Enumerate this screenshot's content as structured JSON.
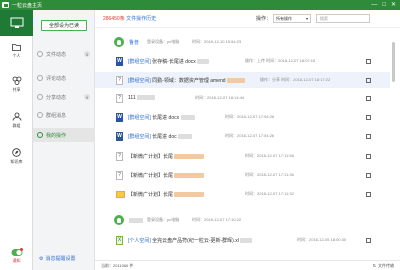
{
  "window": {
    "title": "一粒云盘主页",
    "controls": [
      "—",
      "□",
      "✕"
    ]
  },
  "leftnav": {
    "items": [
      {
        "label": "个人",
        "icon": "folder-icon"
      },
      {
        "label": "共享",
        "icon": "share-icon"
      },
      {
        "label": "群组",
        "icon": "group-icon"
      },
      {
        "label": "知识库",
        "icon": "compass-icon"
      }
    ],
    "bottom": {
      "label": "通知",
      "badge": ""
    }
  },
  "subnav": {
    "mark_read": "全部设为已读",
    "items": [
      {
        "label": "文件动态",
        "count": "5"
      },
      {
        "label": "评论动态",
        "count": ""
      },
      {
        "label": "分享动态",
        "count": "9"
      },
      {
        "label": "群组消息",
        "count": ""
      },
      {
        "label": "我的操作",
        "count": ""
      }
    ],
    "footer": "消息提醒设置"
  },
  "toolbar": {
    "count": "286450",
    "count_suffix": "条",
    "history_label": "文件操作历史",
    "operation_label": "操作：",
    "operation_select": "所有操作",
    "search_placeholder": "搜索"
  },
  "groups": [
    {
      "name": "鲁普",
      "meta": "登录设备：pc电脑",
      "time": "时间：2018-12-10 15:54:23"
    },
    {
      "name": "",
      "meta": "登录设备：pc电脑",
      "time": "时间：2018-12-07 17:10:22"
    }
  ],
  "rows": [
    {
      "tag": "[群组空间]",
      "text": "张存稿-长尾进 docx",
      "meta": "操作：上传   时间：2018-12-07 18:07:15"
    },
    {
      "tag": "[群组空间]",
      "text": "同勤-领域：数据资产管理 amend",
      "meta": "操作：分享   时间：2018-12-07 18:17:22"
    },
    {
      "tag": "",
      "text": "111",
      "meta": "时间：2018-12-07 18:14:44"
    },
    {
      "tag": "[群组空间]",
      "text": "长尾进 docx",
      "meta": "时间：2018-12-07 17:54:26"
    },
    {
      "tag": "[群组空间]",
      "text": "长尾进 doc",
      "meta": "时间：2018-12-07 17:54:26"
    },
    {
      "tag": "",
      "text": "【新微广计划】长尾",
      "meta": "时间：2018-12-07 17:11:58"
    },
    {
      "tag": "",
      "text": "【新微广计划】长尾",
      "meta": "时间：2018-12-07 17:11:36"
    },
    {
      "tag": "",
      "text": "【新微广计划】长尾",
      "meta": "时间：2018-12-07 17:11:32"
    },
    {
      "tag": "[个人空间]",
      "text": "全完云盘产品符(纪一粒云-更新-群晖).xl",
      "meta": "时间：2018-12-05 18:00:30"
    }
  ],
  "statusbar": {
    "left": "当前：2011060 件",
    "right": "文件传输"
  },
  "colors": {
    "brand": "#2e8b3a",
    "link": "#2e6fd0",
    "alert": "#e53935"
  }
}
